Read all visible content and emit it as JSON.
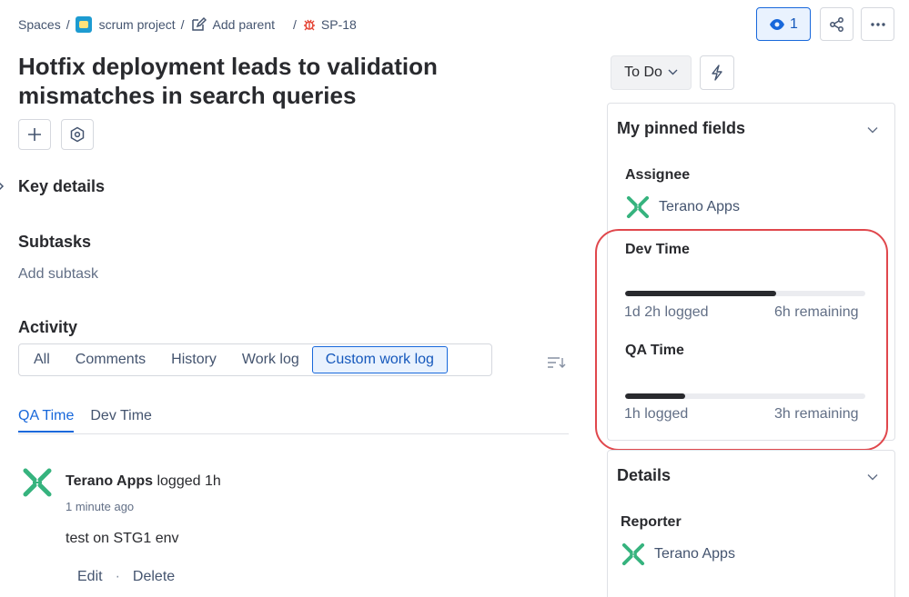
{
  "breadcrumb": {
    "spaces": "Spaces",
    "project": "scrum project",
    "add_parent": "Add parent",
    "issue_key": "SP-18"
  },
  "title": "Hotfix deployment leads to validation mismatches in search queries",
  "sections": {
    "key_details": "Key details",
    "subtasks": "Subtasks",
    "add_subtask": "Add subtask",
    "activity": "Activity"
  },
  "activity_tabs": [
    "All",
    "Comments",
    "History",
    "Work log",
    "Custom work log"
  ],
  "activity_active_tab": "Custom work log",
  "subtabs": [
    "QA Time",
    "Dev Time"
  ],
  "subtabs_active": "QA Time",
  "log_entry": {
    "user": "Terano Apps",
    "action": "logged 1h",
    "time": "1 minute ago",
    "text": "test on STG1 env",
    "edit": "Edit",
    "separator": "·",
    "delete": "Delete"
  },
  "header_actions": {
    "watch_count": "1",
    "share_icon": "share-icon",
    "more_icon": "more-icon"
  },
  "status": {
    "label": "To Do"
  },
  "pinned": {
    "title": "My pinned fields",
    "assignee_label": "Assignee",
    "assignee": "Terano Apps",
    "dev_time": {
      "label": "Dev Time",
      "logged": "1d 2h logged",
      "remaining": "6h remaining",
      "progress": 0.63
    },
    "qa_time": {
      "label": "QA Time",
      "logged": "1h logged",
      "remaining": "3h remaining",
      "progress": 0.25
    }
  },
  "details": {
    "title": "Details",
    "reporter_label": "Reporter",
    "reporter": "Terano Apps"
  },
  "colors": {
    "accent": "#1868db",
    "highlight": "#e0474c",
    "logo_green": "#36b37e"
  }
}
